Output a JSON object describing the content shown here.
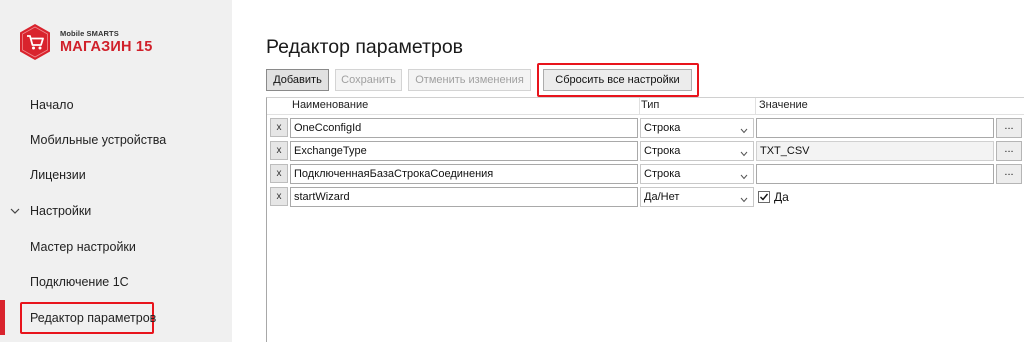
{
  "brand": {
    "small": "Mobile SMARTS",
    "big": "МАГАЗИН 15",
    "accent": "#d9232d"
  },
  "sidebar": {
    "items": [
      {
        "label": "Начало"
      },
      {
        "label": "Мобильные устройства"
      },
      {
        "label": "Лицензии"
      },
      {
        "label": "Настройки",
        "expanded": true
      },
      {
        "label": "Мастер настройки"
      },
      {
        "label": "Подключение 1С"
      },
      {
        "label": "Редактор параметров",
        "active": true
      }
    ]
  },
  "main": {
    "title": "Редактор параметров",
    "toolbar": {
      "add": "Добавить",
      "save": "Сохранить",
      "cancel": "Отменить изменения",
      "reset": "Сбросить все настройки"
    },
    "columns": {
      "name": "Наименование",
      "type": "Тип",
      "value": "Значение"
    },
    "rows": [
      {
        "delete": "x",
        "name": "OneCconfigId",
        "type": "Строка",
        "value": "",
        "browse": "..."
      },
      {
        "delete": "x",
        "name": "ExchangeType",
        "type": "Строка",
        "value": "TXT_CSV",
        "browse": "..."
      },
      {
        "delete": "x",
        "name": "ПодключеннаяБазаСтрокаСоединения",
        "type": "Строка",
        "value": "",
        "browse": "..."
      },
      {
        "delete": "x",
        "name": "startWizard",
        "type": "Да/Нет",
        "checked": true,
        "check_label": "Да"
      }
    ]
  }
}
